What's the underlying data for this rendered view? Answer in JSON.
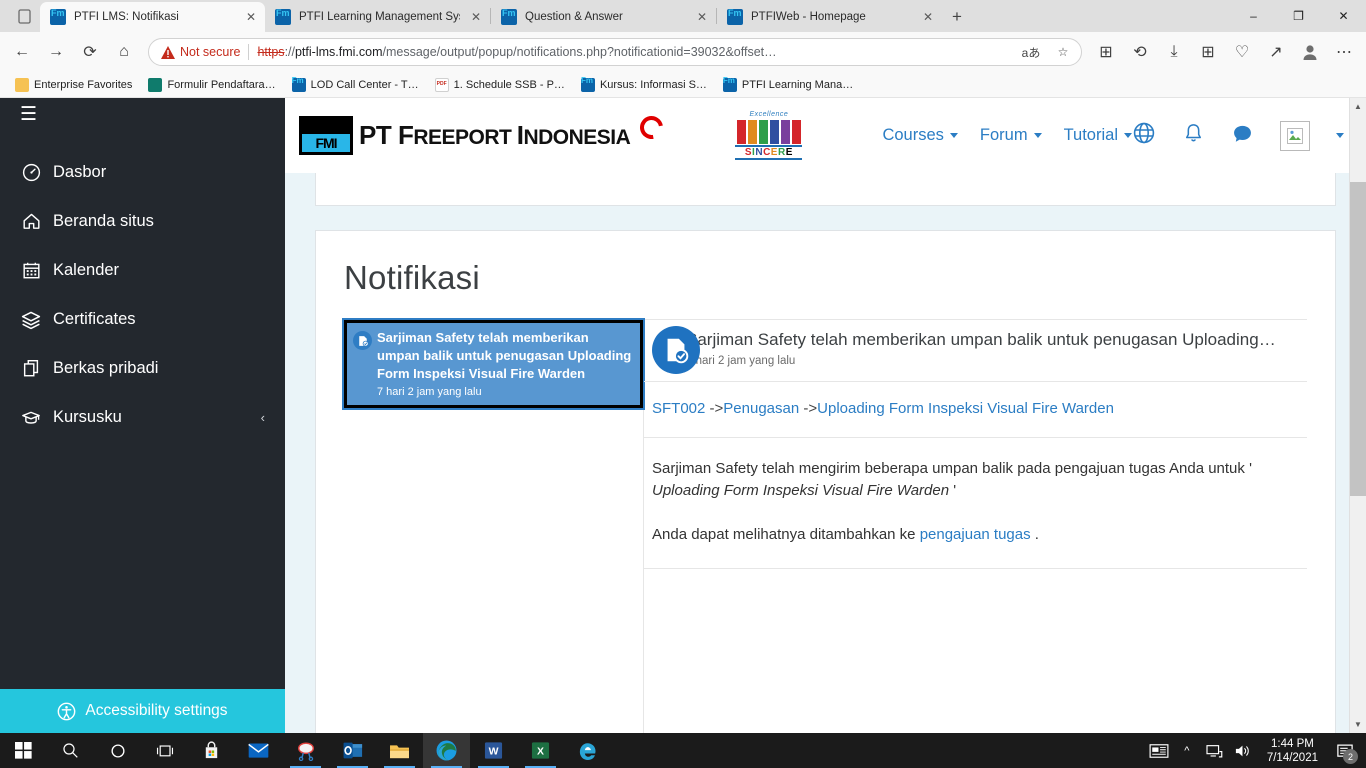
{
  "browser": {
    "tabs": [
      {
        "title": "PTFI LMS: Notifikasi",
        "active": true
      },
      {
        "title": "PTFI Learning Management Syst",
        "active": false
      },
      {
        "title": "Question & Answer",
        "active": false
      },
      {
        "title": "PTFIWeb - Homepage",
        "active": false
      }
    ],
    "new_tab_label": "+",
    "close_label": "✕",
    "window_controls": {
      "minimize": "‒",
      "maximize": "❐",
      "close": "✕"
    },
    "security_label": "Not secure",
    "url": {
      "scheme": "https",
      "separator": "://",
      "host": "ptfi-lms.fmi.com",
      "path": "/message/output/popup/notifications.php?notificationid=39032&offset…"
    },
    "omnibox_icons": {
      "read_aloud": "aあ",
      "favorite": "☆"
    },
    "toolbar_icons": {
      "back": "←",
      "forward": "→",
      "refresh": "⟳",
      "home": "⌂",
      "collections": "⊞",
      "history": "⟲",
      "downloads": "⤓",
      "apps": "⊞",
      "browser_essentials": "♡",
      "share": "↗",
      "profile": "person-icon",
      "settings_more": "⋯"
    },
    "bookmarks": [
      {
        "label": "Enterprise Favorites",
        "icon": "folder"
      },
      {
        "label": "Formulir Pendaftara…",
        "icon": "forms"
      },
      {
        "label": "LOD Call Center - T…",
        "icon": "fmi"
      },
      {
        "label": "1. Schedule SSB - P…",
        "icon": "pdf"
      },
      {
        "label": "Kursus: Informasi S…",
        "icon": "fmi"
      },
      {
        "label": "PTFI Learning Mana…",
        "icon": "fmi"
      }
    ]
  },
  "sidebar": {
    "menu_toggle": "☰",
    "items": [
      {
        "label": "Dasbor",
        "icon": "dashboard-icon"
      },
      {
        "label": "Beranda situs",
        "icon": "home-icon"
      },
      {
        "label": "Kalender",
        "icon": "calendar-icon"
      },
      {
        "label": "Certificates",
        "icon": "layers-icon"
      },
      {
        "label": "Berkas pribadi",
        "icon": "files-icon"
      },
      {
        "label": "Kursusku",
        "icon": "graduation-cap-icon",
        "chevron": "‹"
      }
    ],
    "accessibility": {
      "label": "Accessibility settings",
      "color": "#25c6dd"
    }
  },
  "masthead": {
    "brand": {
      "pt": "PT ",
      "freeport": "F",
      "freeport_rest": "REEPORT ",
      "indonesia": "I",
      "indonesia_rest": "NDONESIA"
    },
    "sincere": {
      "top": "Excellence",
      "word": [
        "S",
        "I",
        "N",
        "C",
        "E",
        "R",
        "E"
      ]
    },
    "nav": [
      {
        "label": "Courses",
        "has_dropdown": true
      },
      {
        "label": "Forum",
        "has_dropdown": true
      },
      {
        "label": "Tutorial",
        "has_dropdown": true
      }
    ],
    "tools": [
      {
        "name": "language-icon",
        "glyph": "🌐"
      },
      {
        "name": "notifications-bell-icon",
        "glyph": "🔔"
      },
      {
        "name": "messages-icon",
        "glyph": "💬"
      }
    ],
    "user_caret": "▾"
  },
  "page": {
    "title": "Notifikasi",
    "notification_list": [
      {
        "title": "Sarjiman Safety telah memberikan umpan balik untuk penugasan Uploading Form Inspeksi Visual Fire Warden",
        "time": "7 hari 2 jam yang lalu",
        "selected": true,
        "icon": "assignment-feedback-icon"
      }
    ],
    "detail": {
      "title": "Sarjiman Safety telah memberikan umpan balik untuk penugasan Uploading For…",
      "time": "7 hari 2 jam yang lalu",
      "icon": "assignment-feedback-icon",
      "breadcrumb": [
        {
          "label": "SFT002",
          "link": true
        },
        {
          "label": " ->",
          "link": false
        },
        {
          "label": "Penugasan",
          "link": true
        },
        {
          "label": " ->",
          "link": false
        },
        {
          "label": "Uploading Form Inspeksi Visual Fire Warden",
          "link": true
        }
      ],
      "body_line1_prefix": "Sarjiman Safety telah mengirim beberapa umpan balik pada pengajuan tugas Anda untuk '",
      "body_line1_italic": "Uploading Form Inspeksi Visual Fire Warden",
      "body_line1_suffix": " '",
      "body_line2_prefix": "Anda dapat melihatnya ditambahkan ke ",
      "body_line2_link": "pengajuan tugas",
      "body_line2_suffix": " ."
    }
  },
  "taskbar": {
    "items": [
      {
        "name": "start-button"
      },
      {
        "name": "search-icon"
      },
      {
        "name": "cortana-icon"
      },
      {
        "name": "task-view-icon"
      },
      {
        "name": "microsoft-store-icon"
      },
      {
        "name": "mail-icon"
      },
      {
        "name": "snip-sketch-icon"
      },
      {
        "name": "outlook-icon"
      },
      {
        "name": "file-explorer-icon"
      },
      {
        "name": "microsoft-edge-icon"
      },
      {
        "name": "word-icon"
      },
      {
        "name": "excel-icon"
      },
      {
        "name": "internet-explorer-icon"
      }
    ],
    "tray": {
      "news_icon": "news-and-interests-icon",
      "overflow": "^",
      "network_icon": "network-icon",
      "volume_icon": "volume-icon"
    },
    "clock": {
      "time": "1:44 PM",
      "date": "7/14/2021"
    },
    "action_center": {
      "badge": "2"
    }
  }
}
